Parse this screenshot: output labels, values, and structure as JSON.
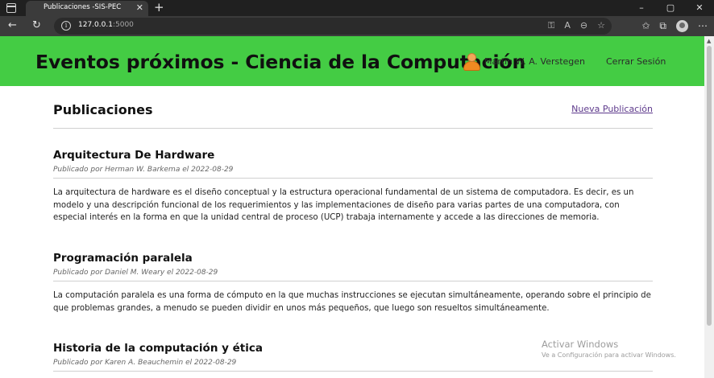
{
  "browser": {
    "tab_title": "Publicaciones -SIS-PEC",
    "tab_close": "✕",
    "new_tab": "+",
    "url_host": "127.0.0.1",
    "url_port": ":5000",
    "window_controls": {
      "minimize": "–",
      "maximize": "▢",
      "close": "✕"
    }
  },
  "header": {
    "title": "Eventos próximos - Ciencia de la Computación",
    "user_name": "Martin W. A. Verstegen",
    "logout": "Cerrar Sesión",
    "bg_color": "#44cc44"
  },
  "page": {
    "title": "Publicaciones",
    "new_link": "Nueva Publicación"
  },
  "posts": [
    {
      "title": "Arquitectura De Hardware",
      "meta": "Publicado por Herman W. Barkema el 2022-08-29",
      "body": "La arquitectura de hardware es el diseño conceptual y la estructura operacional fundamental de un sistema de computadora. Es decir, es un modelo y una descripción funcional de los requerimientos y las implementaciones de diseño para varias partes de una computadora, con especial interés en la forma en que la unidad central de proceso (UCP) trabaja internamente y accede a las direcciones de memoria."
    },
    {
      "title": "Programación paralela",
      "meta": "Publicado por Daniel M. Weary el 2022-08-29",
      "body": "La computación paralela es una forma de cómputo en la que muchas instrucciones se ejecutan simultáneamente,  operando sobre el principio de que problemas grandes, a menudo se pueden dividir en unos más pequeños, que luego son resueltos simultáneamente."
    },
    {
      "title": "Historia de la computación y ética",
      "meta": "Publicado por Karen A. Beauchemin el 2022-08-29",
      "body": ""
    }
  ],
  "watermark": {
    "title": "Activar Windows",
    "subtitle": "Ve a Configuración para activar Windows."
  }
}
